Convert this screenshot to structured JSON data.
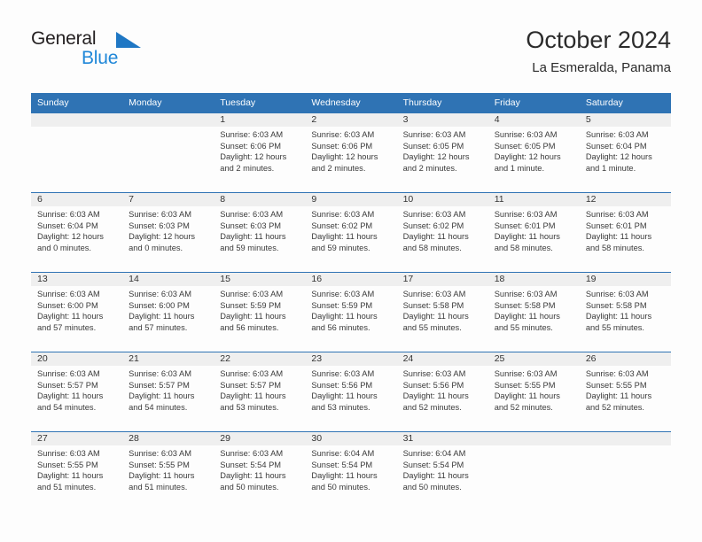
{
  "logo": {
    "word_top": "General",
    "word_bottom": "Blue",
    "triangle_color": "#1f77c4",
    "blue_text_color": "#1f87d8"
  },
  "header": {
    "title": "October 2024",
    "subtitle": "La Esmeralda, Panama"
  },
  "theme": {
    "header_blue": "#2f73b4",
    "row_band_gray": "#efefef",
    "text_color": "#3a3a3a"
  },
  "weekdays": [
    "Sunday",
    "Monday",
    "Tuesday",
    "Wednesday",
    "Thursday",
    "Friday",
    "Saturday"
  ],
  "weeks": [
    [
      {
        "day": "",
        "sunrise": "",
        "sunset": "",
        "daylight1": "",
        "daylight2": ""
      },
      {
        "day": "",
        "sunrise": "",
        "sunset": "",
        "daylight1": "",
        "daylight2": ""
      },
      {
        "day": "1",
        "sunrise": "Sunrise: 6:03 AM",
        "sunset": "Sunset: 6:06 PM",
        "daylight1": "Daylight: 12 hours",
        "daylight2": "and 2 minutes."
      },
      {
        "day": "2",
        "sunrise": "Sunrise: 6:03 AM",
        "sunset": "Sunset: 6:06 PM",
        "daylight1": "Daylight: 12 hours",
        "daylight2": "and 2 minutes."
      },
      {
        "day": "3",
        "sunrise": "Sunrise: 6:03 AM",
        "sunset": "Sunset: 6:05 PM",
        "daylight1": "Daylight: 12 hours",
        "daylight2": "and 2 minutes."
      },
      {
        "day": "4",
        "sunrise": "Sunrise: 6:03 AM",
        "sunset": "Sunset: 6:05 PM",
        "daylight1": "Daylight: 12 hours",
        "daylight2": "and 1 minute."
      },
      {
        "day": "5",
        "sunrise": "Sunrise: 6:03 AM",
        "sunset": "Sunset: 6:04 PM",
        "daylight1": "Daylight: 12 hours",
        "daylight2": "and 1 minute."
      }
    ],
    [
      {
        "day": "6",
        "sunrise": "Sunrise: 6:03 AM",
        "sunset": "Sunset: 6:04 PM",
        "daylight1": "Daylight: 12 hours",
        "daylight2": "and 0 minutes."
      },
      {
        "day": "7",
        "sunrise": "Sunrise: 6:03 AM",
        "sunset": "Sunset: 6:03 PM",
        "daylight1": "Daylight: 12 hours",
        "daylight2": "and 0 minutes."
      },
      {
        "day": "8",
        "sunrise": "Sunrise: 6:03 AM",
        "sunset": "Sunset: 6:03 PM",
        "daylight1": "Daylight: 11 hours",
        "daylight2": "and 59 minutes."
      },
      {
        "day": "9",
        "sunrise": "Sunrise: 6:03 AM",
        "sunset": "Sunset: 6:02 PM",
        "daylight1": "Daylight: 11 hours",
        "daylight2": "and 59 minutes."
      },
      {
        "day": "10",
        "sunrise": "Sunrise: 6:03 AM",
        "sunset": "Sunset: 6:02 PM",
        "daylight1": "Daylight: 11 hours",
        "daylight2": "and 58 minutes."
      },
      {
        "day": "11",
        "sunrise": "Sunrise: 6:03 AM",
        "sunset": "Sunset: 6:01 PM",
        "daylight1": "Daylight: 11 hours",
        "daylight2": "and 58 minutes."
      },
      {
        "day": "12",
        "sunrise": "Sunrise: 6:03 AM",
        "sunset": "Sunset: 6:01 PM",
        "daylight1": "Daylight: 11 hours",
        "daylight2": "and 58 minutes."
      }
    ],
    [
      {
        "day": "13",
        "sunrise": "Sunrise: 6:03 AM",
        "sunset": "Sunset: 6:00 PM",
        "daylight1": "Daylight: 11 hours",
        "daylight2": "and 57 minutes."
      },
      {
        "day": "14",
        "sunrise": "Sunrise: 6:03 AM",
        "sunset": "Sunset: 6:00 PM",
        "daylight1": "Daylight: 11 hours",
        "daylight2": "and 57 minutes."
      },
      {
        "day": "15",
        "sunrise": "Sunrise: 6:03 AM",
        "sunset": "Sunset: 5:59 PM",
        "daylight1": "Daylight: 11 hours",
        "daylight2": "and 56 minutes."
      },
      {
        "day": "16",
        "sunrise": "Sunrise: 6:03 AM",
        "sunset": "Sunset: 5:59 PM",
        "daylight1": "Daylight: 11 hours",
        "daylight2": "and 56 minutes."
      },
      {
        "day": "17",
        "sunrise": "Sunrise: 6:03 AM",
        "sunset": "Sunset: 5:58 PM",
        "daylight1": "Daylight: 11 hours",
        "daylight2": "and 55 minutes."
      },
      {
        "day": "18",
        "sunrise": "Sunrise: 6:03 AM",
        "sunset": "Sunset: 5:58 PM",
        "daylight1": "Daylight: 11 hours",
        "daylight2": "and 55 minutes."
      },
      {
        "day": "19",
        "sunrise": "Sunrise: 6:03 AM",
        "sunset": "Sunset: 5:58 PM",
        "daylight1": "Daylight: 11 hours",
        "daylight2": "and 55 minutes."
      }
    ],
    [
      {
        "day": "20",
        "sunrise": "Sunrise: 6:03 AM",
        "sunset": "Sunset: 5:57 PM",
        "daylight1": "Daylight: 11 hours",
        "daylight2": "and 54 minutes."
      },
      {
        "day": "21",
        "sunrise": "Sunrise: 6:03 AM",
        "sunset": "Sunset: 5:57 PM",
        "daylight1": "Daylight: 11 hours",
        "daylight2": "and 54 minutes."
      },
      {
        "day": "22",
        "sunrise": "Sunrise: 6:03 AM",
        "sunset": "Sunset: 5:57 PM",
        "daylight1": "Daylight: 11 hours",
        "daylight2": "and 53 minutes."
      },
      {
        "day": "23",
        "sunrise": "Sunrise: 6:03 AM",
        "sunset": "Sunset: 5:56 PM",
        "daylight1": "Daylight: 11 hours",
        "daylight2": "and 53 minutes."
      },
      {
        "day": "24",
        "sunrise": "Sunrise: 6:03 AM",
        "sunset": "Sunset: 5:56 PM",
        "daylight1": "Daylight: 11 hours",
        "daylight2": "and 52 minutes."
      },
      {
        "day": "25",
        "sunrise": "Sunrise: 6:03 AM",
        "sunset": "Sunset: 5:55 PM",
        "daylight1": "Daylight: 11 hours",
        "daylight2": "and 52 minutes."
      },
      {
        "day": "26",
        "sunrise": "Sunrise: 6:03 AM",
        "sunset": "Sunset: 5:55 PM",
        "daylight1": "Daylight: 11 hours",
        "daylight2": "and 52 minutes."
      }
    ],
    [
      {
        "day": "27",
        "sunrise": "Sunrise: 6:03 AM",
        "sunset": "Sunset: 5:55 PM",
        "daylight1": "Daylight: 11 hours",
        "daylight2": "and 51 minutes."
      },
      {
        "day": "28",
        "sunrise": "Sunrise: 6:03 AM",
        "sunset": "Sunset: 5:55 PM",
        "daylight1": "Daylight: 11 hours",
        "daylight2": "and 51 minutes."
      },
      {
        "day": "29",
        "sunrise": "Sunrise: 6:03 AM",
        "sunset": "Sunset: 5:54 PM",
        "daylight1": "Daylight: 11 hours",
        "daylight2": "and 50 minutes."
      },
      {
        "day": "30",
        "sunrise": "Sunrise: 6:04 AM",
        "sunset": "Sunset: 5:54 PM",
        "daylight1": "Daylight: 11 hours",
        "daylight2": "and 50 minutes."
      },
      {
        "day": "31",
        "sunrise": "Sunrise: 6:04 AM",
        "sunset": "Sunset: 5:54 PM",
        "daylight1": "Daylight: 11 hours",
        "daylight2": "and 50 minutes."
      },
      {
        "day": "",
        "sunrise": "",
        "sunset": "",
        "daylight1": "",
        "daylight2": ""
      },
      {
        "day": "",
        "sunrise": "",
        "sunset": "",
        "daylight1": "",
        "daylight2": ""
      }
    ]
  ]
}
